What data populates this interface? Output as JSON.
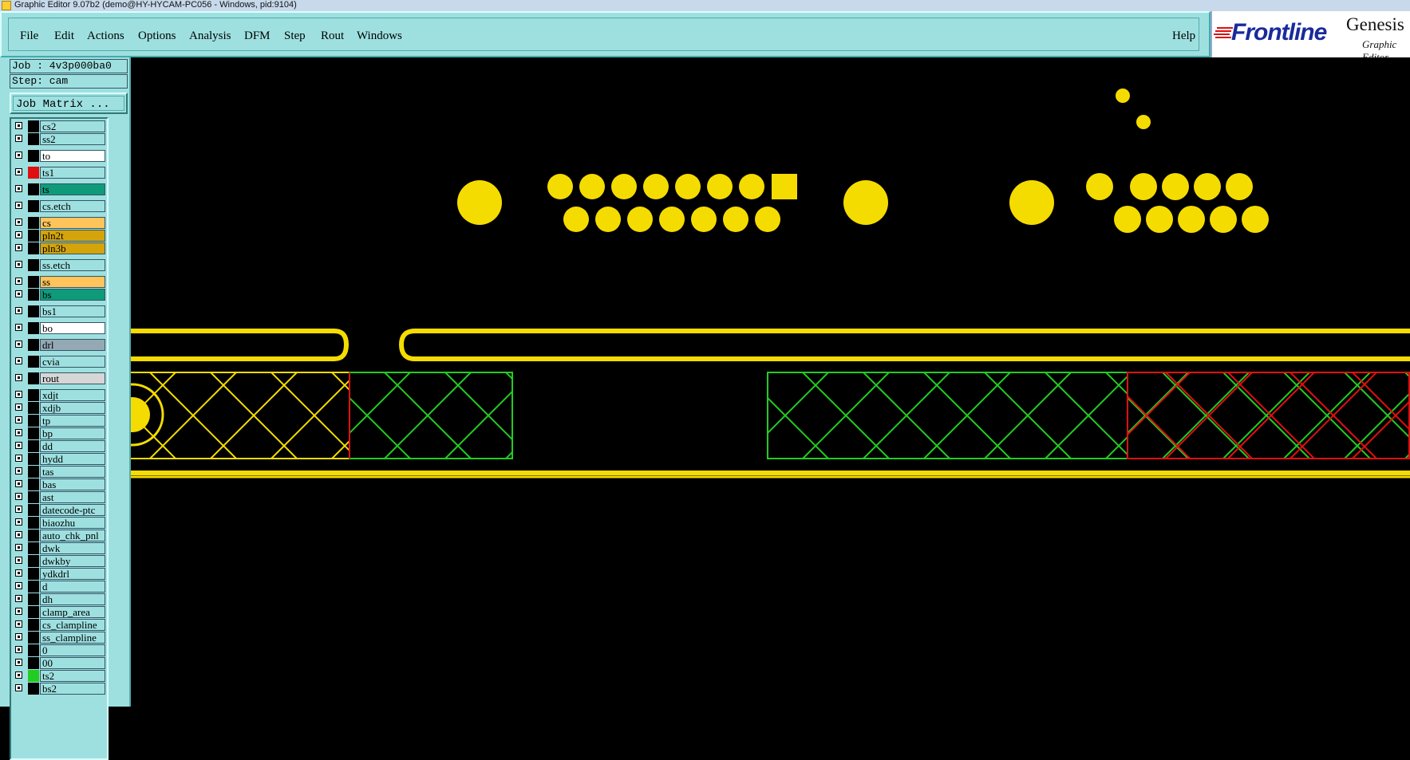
{
  "window": {
    "title": "Graphic Editor 9.07b2 (demo@HY-HYCAM-PC056 - Windows, pid:9104)"
  },
  "menu": {
    "items": [
      {
        "id": "file",
        "label": "File"
      },
      {
        "id": "edit",
        "label": "Edit"
      },
      {
        "id": "actions",
        "label": "Actions"
      },
      {
        "id": "options",
        "label": "Options"
      },
      {
        "id": "analysis",
        "label": "Analysis"
      },
      {
        "id": "dfm",
        "label": "DFM"
      },
      {
        "id": "step",
        "label": "Step"
      },
      {
        "id": "rout",
        "label": "Rout"
      },
      {
        "id": "windows",
        "label": "Windows"
      }
    ],
    "help": "Help"
  },
  "logo": {
    "brand": "Frontline",
    "product": "Genesis",
    "subtitle": "Graphic Editor"
  },
  "job": {
    "label": "Job : 4v3p000ba0",
    "step": "Step: cam",
    "matrix_button": "Job Matrix ..."
  },
  "colors": {
    "panel": "#9ee0e0",
    "yellow": "#f5dc00",
    "green": "#22cc22",
    "red": "#e01010",
    "canvas": "#000000"
  },
  "layers": [
    {
      "name": "cs2",
      "color": "#9ee0e0",
      "swatch": "#000000"
    },
    {
      "name": "ss2",
      "color": "#9ee0e0",
      "swatch": "#000000"
    },
    {
      "name": "to",
      "color": "#ffffff",
      "swatch": "#000000"
    },
    {
      "name": "ts1",
      "color": "#9ee0e0",
      "swatch": "#e01010",
      "work": true
    },
    {
      "name": "ts",
      "color": "#0f9a7a",
      "swatch": "#000000"
    },
    {
      "name": "cs.etch",
      "color": "#9ee0e0",
      "swatch": "#000000"
    },
    {
      "name": "cs",
      "color": "#ffc45a",
      "swatch": "#000000"
    },
    {
      "name": "pln2t",
      "color": "#d4a40a",
      "swatch": "#000000"
    },
    {
      "name": "pln3b",
      "color": "#d4a40a",
      "swatch": "#000000"
    },
    {
      "name": "ss.etch",
      "color": "#9ee0e0",
      "swatch": "#000000"
    },
    {
      "name": "ss",
      "color": "#ffc45a",
      "swatch": "#000000"
    },
    {
      "name": "bs",
      "color": "#0f9a7a",
      "swatch": "#000000"
    },
    {
      "name": "bs1",
      "color": "#9ee0e0",
      "swatch": "#000000"
    },
    {
      "name": "bo",
      "color": "#ffffff",
      "swatch": "#000000"
    },
    {
      "name": "drl",
      "color": "#95a9b5",
      "swatch": "#000000"
    },
    {
      "name": "cvia",
      "color": "#9ee0e0",
      "swatch": "#000000"
    },
    {
      "name": "rout",
      "color": "#d6d6d6",
      "swatch": "#000000"
    },
    {
      "name": "xdjt",
      "color": "#9ee0e0",
      "swatch": "#000000"
    },
    {
      "name": "xdjb",
      "color": "#9ee0e0",
      "swatch": "#000000"
    },
    {
      "name": "tp",
      "color": "#9ee0e0",
      "swatch": "#000000"
    },
    {
      "name": "bp",
      "color": "#9ee0e0",
      "swatch": "#000000"
    },
    {
      "name": "dd",
      "color": "#9ee0e0",
      "swatch": "#000000"
    },
    {
      "name": "hydd",
      "color": "#9ee0e0",
      "swatch": "#000000"
    },
    {
      "name": "tas",
      "color": "#9ee0e0",
      "swatch": "#000000"
    },
    {
      "name": "bas",
      "color": "#9ee0e0",
      "swatch": "#000000"
    },
    {
      "name": "ast",
      "color": "#9ee0e0",
      "swatch": "#000000"
    },
    {
      "name": "datecode-ptc",
      "color": "#9ee0e0",
      "swatch": "#000000"
    },
    {
      "name": "biaozhu",
      "color": "#9ee0e0",
      "swatch": "#000000"
    },
    {
      "name": "auto_chk_pnl",
      "color": "#9ee0e0",
      "swatch": "#000000"
    },
    {
      "name": "dwk",
      "color": "#9ee0e0",
      "swatch": "#000000"
    },
    {
      "name": "dwkby",
      "color": "#9ee0e0",
      "swatch": "#000000"
    },
    {
      "name": "ydkdrl",
      "color": "#9ee0e0",
      "swatch": "#000000"
    },
    {
      "name": "d",
      "color": "#9ee0e0",
      "swatch": "#000000"
    },
    {
      "name": "dh",
      "color": "#9ee0e0",
      "swatch": "#000000"
    },
    {
      "name": "clamp_area",
      "color": "#9ee0e0",
      "swatch": "#000000"
    },
    {
      "name": "cs_clampline",
      "color": "#9ee0e0",
      "swatch": "#000000"
    },
    {
      "name": "ss_clampline",
      "color": "#9ee0e0",
      "swatch": "#000000"
    },
    {
      "name": "0",
      "color": "#9ee0e0",
      "swatch": "#000000"
    },
    {
      "name": "00",
      "color": "#9ee0e0",
      "swatch": "#000000"
    },
    {
      "name": "ts2",
      "color": "#9ee0e0",
      "swatch": "#22cc22"
    },
    {
      "name": "bs2",
      "color": "#9ee0e0",
      "swatch": "#000000"
    }
  ]
}
